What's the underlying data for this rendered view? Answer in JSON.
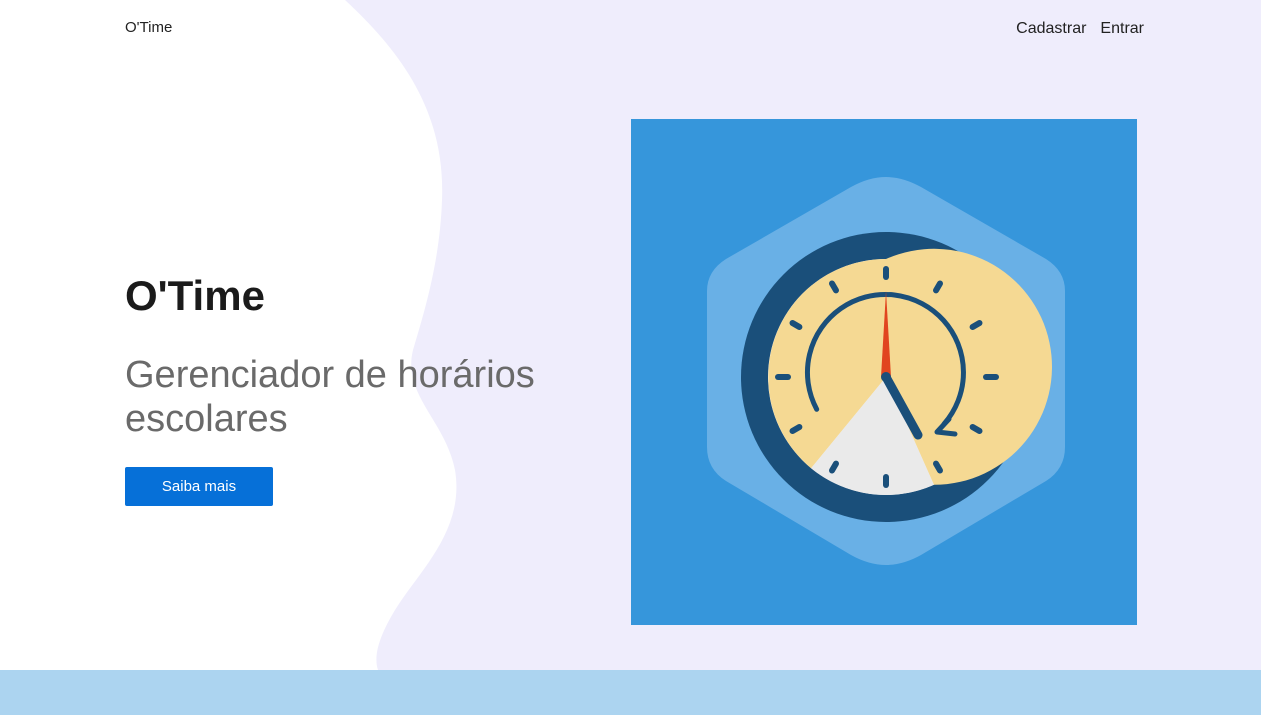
{
  "nav": {
    "brand": "O'Time",
    "links": {
      "register": "Cadastrar",
      "login": "Entrar"
    }
  },
  "hero": {
    "title": "O'Time",
    "subtitle": "Gerenciador de horários escolares",
    "cta_label": "Saiba mais"
  },
  "illustration": {
    "icon": "clock-icon",
    "colors": {
      "background": "#3696db",
      "hexagon": "#69b0e6",
      "clock_ring": "#1a4f7a",
      "clock_face": "#f5f5f5",
      "elapsed_sector": "#f5d993",
      "second_hand": "#e1451f"
    }
  },
  "colors": {
    "page_background": "#efedfc",
    "wave": "#ffffff",
    "accent": "#0670d8",
    "footer": "#acd4f0"
  }
}
